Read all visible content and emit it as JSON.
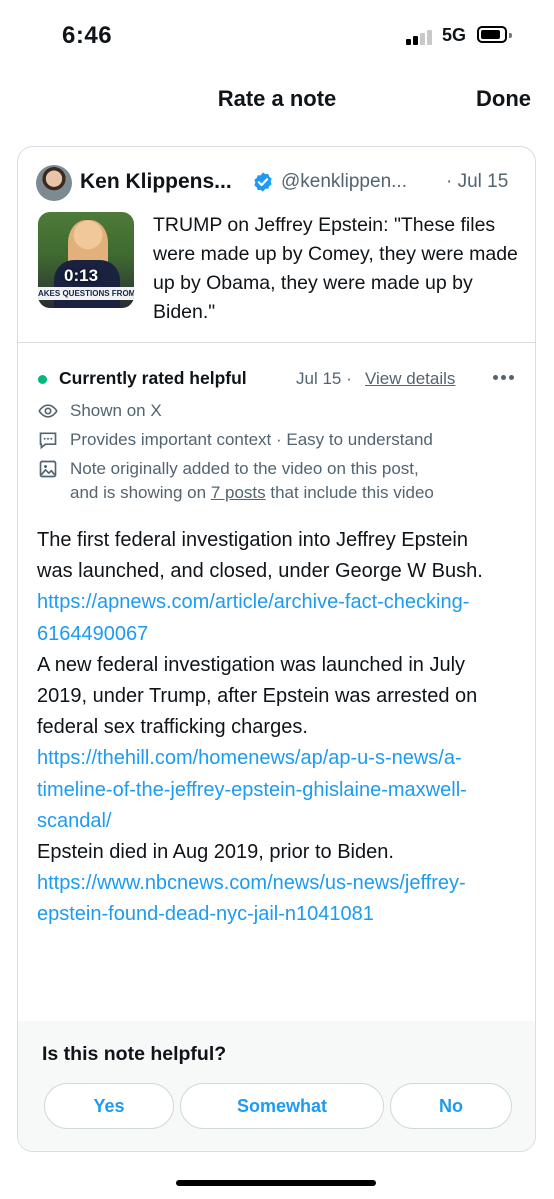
{
  "status_bar": {
    "time": "6:46",
    "network": "5G"
  },
  "nav": {
    "title": "Rate a note",
    "done_label": "Done"
  },
  "post": {
    "author_name": "Ken Klippens...",
    "handle": "@kenklippen...",
    "date": "· Jul 15",
    "text": "TRUMP on Jeffrey Epstein: \"These files were made up by Comey, they were made up by Obama, they were made up by Biden.\"",
    "video": {
      "duration": "0:13",
      "ticker": "AKES QUESTIONS FROM REPORTERS"
    }
  },
  "note": {
    "status_label": "Currently rated helpful",
    "status_date": "Jul 15 ·",
    "view_details": "View details",
    "shown_on": "Shown on X",
    "reasons": "Provides important context · Easy to understand",
    "origin_line1": "Note originally added to the video on this post,",
    "origin_pre": "and is showing on ",
    "origin_link": "7 posts",
    "origin_post": " that include this video",
    "body": [
      {
        "type": "text",
        "value": "The first federal investigation into Jeffrey Epstein was launched, and closed, under George W Bush."
      },
      {
        "type": "link",
        "value": "https://apnews.com/article/archive-fact-checking-6164490067"
      },
      {
        "type": "text",
        "value": "A new federal investigation was launched in July 2019, under Trump, after Epstein was arrested on federal sex trafficking charges."
      },
      {
        "type": "link",
        "value": "https://thehill.com/homenews/ap/ap-u-s-news/a-timeline-of-the-jeffrey-epstein-ghislaine-maxwell-scandal/"
      },
      {
        "type": "text",
        "value": "Epstein died in Aug 2019, prior to Biden."
      },
      {
        "type": "link",
        "value": "https://www.nbcnews.com/news/us-news/jeffrey-epstein-found-dead-nyc-jail-n1041081"
      }
    ]
  },
  "rating": {
    "question": "Is this note helpful?",
    "options": [
      "Yes",
      "Somewhat",
      "No"
    ]
  },
  "colors": {
    "accent": "#1d9bf0",
    "helpful": "#00ba7c",
    "muted": "#536471"
  }
}
